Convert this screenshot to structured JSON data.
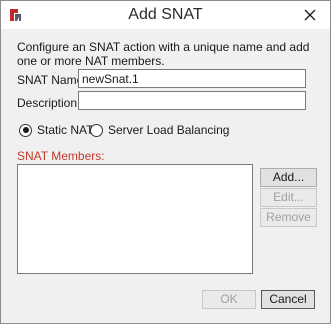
{
  "window": {
    "title": "Add SNAT",
    "app_icon": "app-logo-icon",
    "close_icon": "close-icon"
  },
  "intro_text": "Configure an SNAT action with a unique name and add one or more NAT members.",
  "form": {
    "name_label": "SNAT Name:",
    "name_value": "newSnat.1",
    "description_label": "Description:",
    "description_value": ""
  },
  "mode": {
    "options": [
      {
        "label": "Static NAT",
        "selected": true
      },
      {
        "label": "Server Load Balancing",
        "selected": false
      }
    ]
  },
  "members": {
    "label": "SNAT Members:",
    "items": []
  },
  "member_buttons": {
    "add": "Add...",
    "edit": "Edit...",
    "remove": "Remove"
  },
  "footer": {
    "ok": "OK",
    "cancel": "Cancel"
  },
  "colors": {
    "section_label": "#c0392b",
    "icon_red": "#c0282d"
  }
}
